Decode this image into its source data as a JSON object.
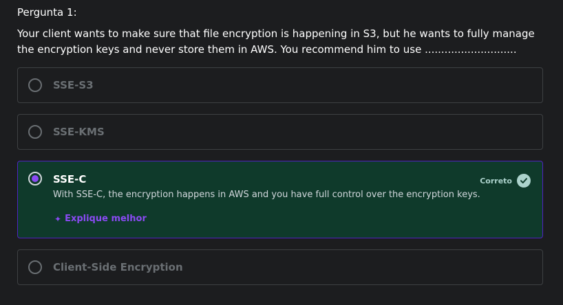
{
  "question": {
    "label": "Pergunta 1:",
    "text": "Your client wants to make sure that file encryption is happening in S3, but he wants to fully manage the encryption keys and never store them in AWS. You recommend him to use ............................"
  },
  "options": [
    {
      "label": "SSE-S3"
    },
    {
      "label": "SSE-KMS"
    },
    {
      "label": "SSE-C",
      "status": "Correto",
      "explanation": "With SSE-C, the encryption happens in AWS and you have full control over the encryption keys.",
      "explain_more": "Explique melhor"
    },
    {
      "label": "Client-Side Encryption"
    }
  ],
  "colors": {
    "background": "#1c1d1f",
    "correct_bg": "#0f3a2b",
    "accent_purple": "#8a4af3",
    "correct_mint": "#acd2cc"
  },
  "icons": {
    "correct": "check-circle-icon",
    "explain": "sparkle-icon"
  }
}
